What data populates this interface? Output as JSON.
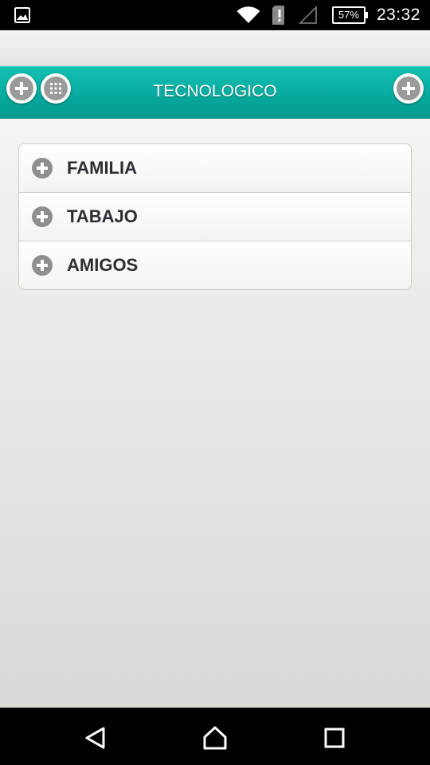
{
  "status_bar": {
    "notification_icon": "image-icon",
    "icons": [
      "wifi-icon",
      "alert-icon",
      "signal-icon"
    ],
    "battery": "57%",
    "time": "23:32"
  },
  "header": {
    "title": "TECNOLOGICO",
    "left_buttons": [
      "add-icon",
      "grid-icon"
    ],
    "right_button": "add-icon",
    "color": "#08a89d"
  },
  "list": {
    "items": [
      {
        "label": "FAMILIA",
        "icon": "plus-circle-icon"
      },
      {
        "label": "TABAJO",
        "icon": "plus-circle-icon"
      },
      {
        "label": "AMIGOS",
        "icon": "plus-circle-icon"
      }
    ]
  },
  "nav_bar": {
    "buttons": [
      "back-icon",
      "home-icon",
      "recents-icon"
    ]
  }
}
